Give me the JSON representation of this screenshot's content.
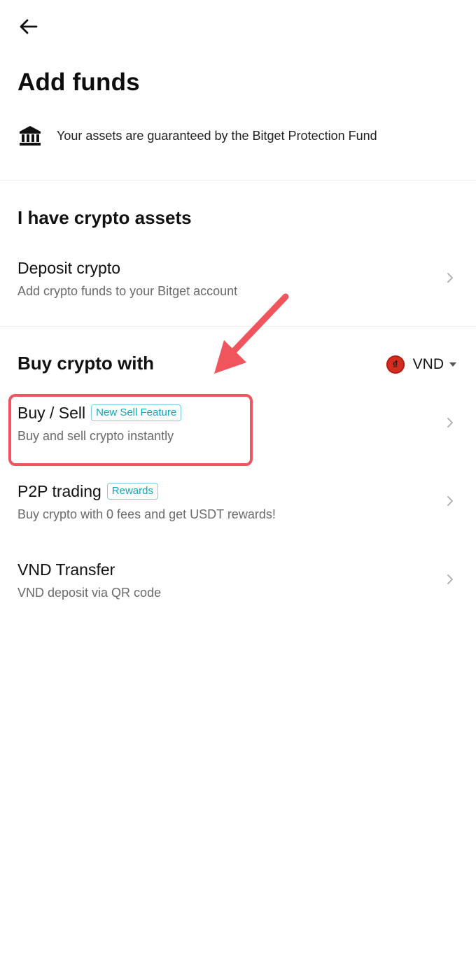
{
  "header": {
    "title": "Add funds",
    "protection_text": "Your assets are guaranteed by the Bitget Protection Fund"
  },
  "crypto_section": {
    "title": "I have crypto assets",
    "items": [
      {
        "title": "Deposit crypto",
        "subtitle": "Add crypto funds to your Bitget account"
      }
    ]
  },
  "buy_section": {
    "title": "Buy crypto with",
    "currency": {
      "code": "VND",
      "symbol": "₫"
    },
    "items": [
      {
        "title": "Buy / Sell",
        "badge": "New Sell Feature",
        "subtitle": "Buy and sell crypto instantly"
      },
      {
        "title": "P2P trading",
        "badge": "Rewards",
        "subtitle": "Buy crypto with 0 fees and get USDT rewards!"
      },
      {
        "title": "VND Transfer",
        "subtitle": "VND deposit via QR code"
      }
    ]
  },
  "colors": {
    "badge_text": "#0aa7be",
    "badge_border": "#6fd3df",
    "annotation_red": "#f0545c",
    "currency_flag": "#d62c1f"
  },
  "icons": {
    "back": "arrow-left-icon",
    "bank": "bank-icon",
    "chevron": "chevron-right-icon",
    "caret": "caret-down-icon"
  }
}
